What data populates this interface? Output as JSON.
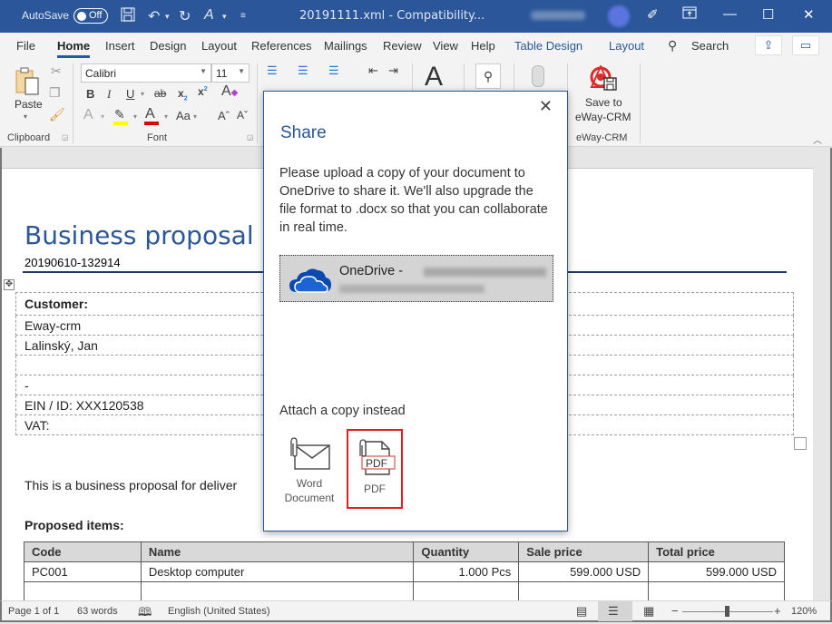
{
  "titlebar": {
    "autosave_label": "AutoSave",
    "autosave_state": "Off",
    "document_title": "20191111.xml  -  Compatibility...",
    "icons": [
      "save-icon",
      "undo-icon",
      "redo-icon",
      "spelling-icon",
      "customize-qat-icon"
    ],
    "window_buttons": {
      "minimize": "—",
      "maximize": "☐",
      "close": "✕"
    }
  },
  "tabs": {
    "items": [
      {
        "label": "File"
      },
      {
        "label": "Home",
        "active": true
      },
      {
        "label": "Insert"
      },
      {
        "label": "Design"
      },
      {
        "label": "Layout"
      },
      {
        "label": "References"
      },
      {
        "label": "Mailings"
      },
      {
        "label": "Review"
      },
      {
        "label": "View"
      },
      {
        "label": "Help"
      },
      {
        "label": "Table Design",
        "contextual": true
      },
      {
        "label": "Layout",
        "contextual": true
      }
    ],
    "search_label": "Search"
  },
  "ribbon": {
    "clipboard": {
      "paste_label": "Paste",
      "group_label": "Clipboard"
    },
    "font": {
      "font_name": "Calibri",
      "font_size": "11",
      "group_label": "Font",
      "highlight_color": "#ffff00",
      "font_color": "#e00000"
    },
    "eway": {
      "save_label_line1": "Save to",
      "save_label_line2": "eWay-CRM",
      "group_label": "eWay-CRM"
    }
  },
  "document": {
    "title": "Business proposal",
    "number": "20190610-132914",
    "customer_rows": [
      "Customer:",
      "Eway-crm",
      "Lalinský, Jan",
      "",
      " -",
      "EIN / ID: XXX120538",
      "VAT:"
    ],
    "paragraph": "This is a business proposal for deliver",
    "items_heading": "Proposed items:",
    "items_table": {
      "headers": [
        "Code",
        "Name",
        "Quantity",
        "Sale price",
        "Total price"
      ],
      "rows": [
        [
          "PC001",
          "Desktop computer",
          "1.000 Pcs",
          "599.000 USD",
          "599.000 USD"
        ]
      ]
    }
  },
  "statusbar": {
    "page": "Page 1 of 1",
    "words": "63 words",
    "language": "English (United States)",
    "zoom": "120%",
    "zoom_minus": "−",
    "zoom_plus": "+"
  },
  "dialog": {
    "title": "Share",
    "close": "✕",
    "message": "Please upload a copy of your document to OneDrive to share it. We'll also upgrade the file format to .docx so that you can collaborate in real time.",
    "onedrive_label": "OneDrive -",
    "attach_heading": "Attach a copy instead",
    "options": [
      {
        "label": "Word Document",
        "selected": false
      },
      {
        "label": "PDF",
        "selected": true
      }
    ],
    "accent_color": "#2b579a",
    "selection_color": "#e02020"
  }
}
